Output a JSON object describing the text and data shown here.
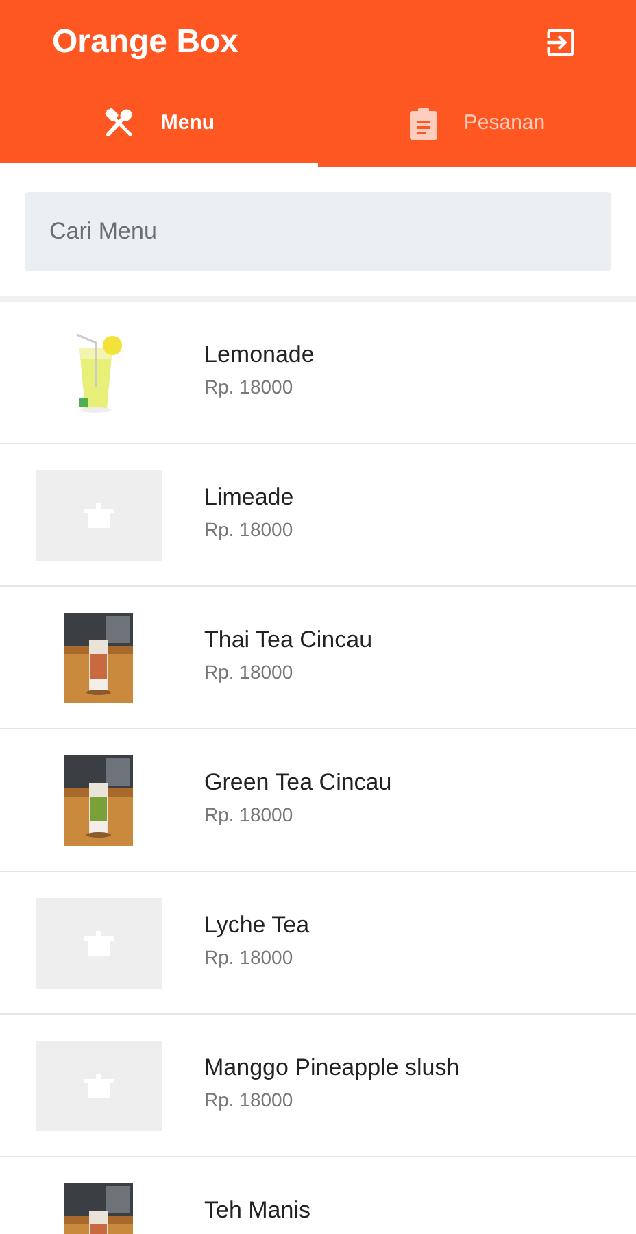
{
  "app_bar": {
    "title": "Orange Box"
  },
  "tabs": [
    {
      "label": "Menu",
      "selected": true,
      "kind": "utensils"
    },
    {
      "label": "Pesanan",
      "selected": false,
      "kind": "clipboard"
    }
  ],
  "search": {
    "placeholder": "Cari Menu"
  },
  "menu_items": [
    {
      "name": "Lemonade",
      "price": "Rp. 18000",
      "kind": "cutout"
    },
    {
      "name": "Limeade",
      "price": "Rp. 18000",
      "kind": "placeholder"
    },
    {
      "name": "Thai Tea Cincau",
      "price": "Rp. 18000"
    },
    {
      "name": "Green Tea Cincau",
      "price": "Rp. 18000"
    },
    {
      "name": "Lyche Tea",
      "price": "Rp. 18000",
      "kind": "placeholder"
    },
    {
      "name": "Manggo Pineapple slush",
      "price": "Rp. 18000",
      "kind": "placeholder"
    },
    {
      "name": "Teh Manis"
    }
  ]
}
